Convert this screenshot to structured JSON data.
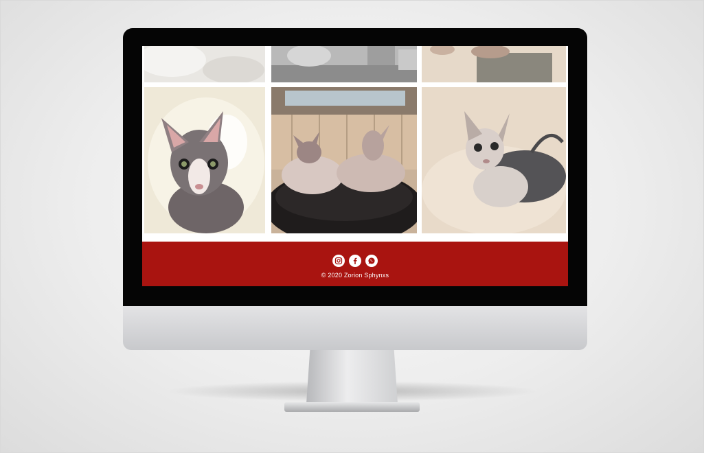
{
  "site": {
    "gallery": {
      "top_row": [
        {
          "name": "bath-foam-photo"
        },
        {
          "name": "bowl-floor-photo"
        },
        {
          "name": "cat-legs-photo"
        }
      ],
      "main_row": [
        {
          "name": "sphynx-cat-in-bath-photo"
        },
        {
          "name": "two-sphynx-cats-on-bed-photo"
        },
        {
          "name": "sphynx-cat-in-foam-photo"
        }
      ]
    },
    "footer": {
      "background": "#a91410",
      "social_icons": [
        "instagram-icon",
        "facebook-icon",
        "whatsapp-icon"
      ],
      "copyright": "© 2020 Zorion Sphynxs"
    }
  }
}
